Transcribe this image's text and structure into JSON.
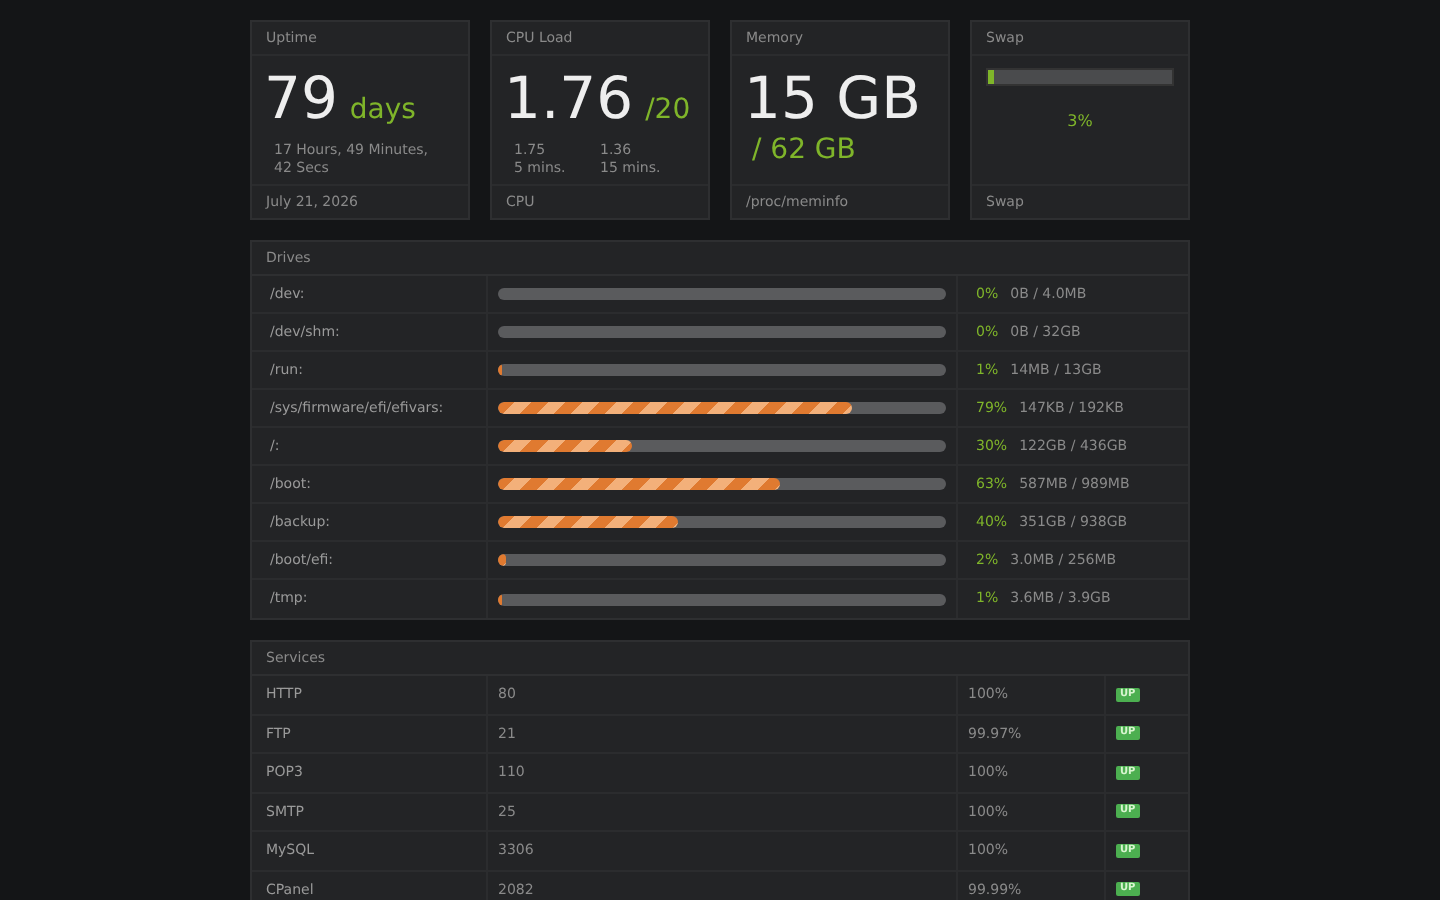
{
  "cards": [
    {
      "kind": "value",
      "title": "Uptime",
      "value": "79",
      "unit": "days",
      "details": [
        {
          "text": "17 Hours, 49 Minutes, 42 Secs"
        }
      ],
      "footer": "July 21, 2026"
    },
    {
      "kind": "value",
      "title": "CPU Load",
      "value": "1.76",
      "unit": "/20",
      "details": [
        {
          "text": "1.75"
        },
        {
          "text": "1.36"
        },
        {
          "text": "5 mins."
        },
        {
          "text": "15 mins."
        }
      ],
      "footer": "CPU"
    },
    {
      "kind": "stacked",
      "title": "Memory",
      "value": "15 GB",
      "unit": "/ 62 GB",
      "footer": "/proc/meminfo"
    },
    {
      "kind": "meter",
      "title": "Swap",
      "level": 0.03,
      "reading": "3%",
      "footer": "Swap"
    }
  ],
  "drives": {
    "title": "Drives",
    "rows": [
      {
        "mount": "/dev:",
        "level": 0,
        "percent": "0%",
        "usage": "0B / 4.0MB"
      },
      {
        "mount": "/dev/shm:",
        "level": 0,
        "percent": "0%",
        "usage": "0B / 32GB"
      },
      {
        "mount": "/run:",
        "level": 0.01,
        "percent": "1%",
        "usage": "14MB / 13GB"
      },
      {
        "mount": "/sys/firmware/efi/efivars:",
        "level": 0.79,
        "percent": "79%",
        "usage": "147KB / 192KB"
      },
      {
        "mount": "/:",
        "level": 0.3,
        "percent": "30%",
        "usage": "122GB / 436GB"
      },
      {
        "mount": "/boot:",
        "level": 0.63,
        "percent": "63%",
        "usage": "587MB / 989MB"
      },
      {
        "mount": "/backup:",
        "level": 0.4,
        "percent": "40%",
        "usage": "351GB / 938GB"
      },
      {
        "mount": "/boot/efi:",
        "level": 0.02,
        "percent": "2%",
        "usage": "3.0MB / 256MB"
      },
      {
        "mount": "/tmp:",
        "level": 0.01,
        "percent": "1%",
        "usage": "3.6MB / 3.9GB"
      }
    ]
  },
  "services": {
    "title": "Services",
    "rows": [
      {
        "name": "HTTP",
        "port": "80",
        "uptime": "100%",
        "status": "UP",
        "up": true
      },
      {
        "name": "FTP",
        "port": "21",
        "uptime": "99.97%",
        "status": "UP",
        "up": true
      },
      {
        "name": "POP3",
        "port": "110",
        "uptime": "100%",
        "status": "UP",
        "up": true
      },
      {
        "name": "SMTP",
        "port": "25",
        "uptime": "100%",
        "status": "UP",
        "up": true
      },
      {
        "name": "MySQL",
        "port": "3306",
        "uptime": "100%",
        "status": "UP",
        "up": true
      },
      {
        "name": "CPanel",
        "port": "2082",
        "uptime": "99.99%",
        "status": "UP",
        "up": true
      }
    ]
  }
}
